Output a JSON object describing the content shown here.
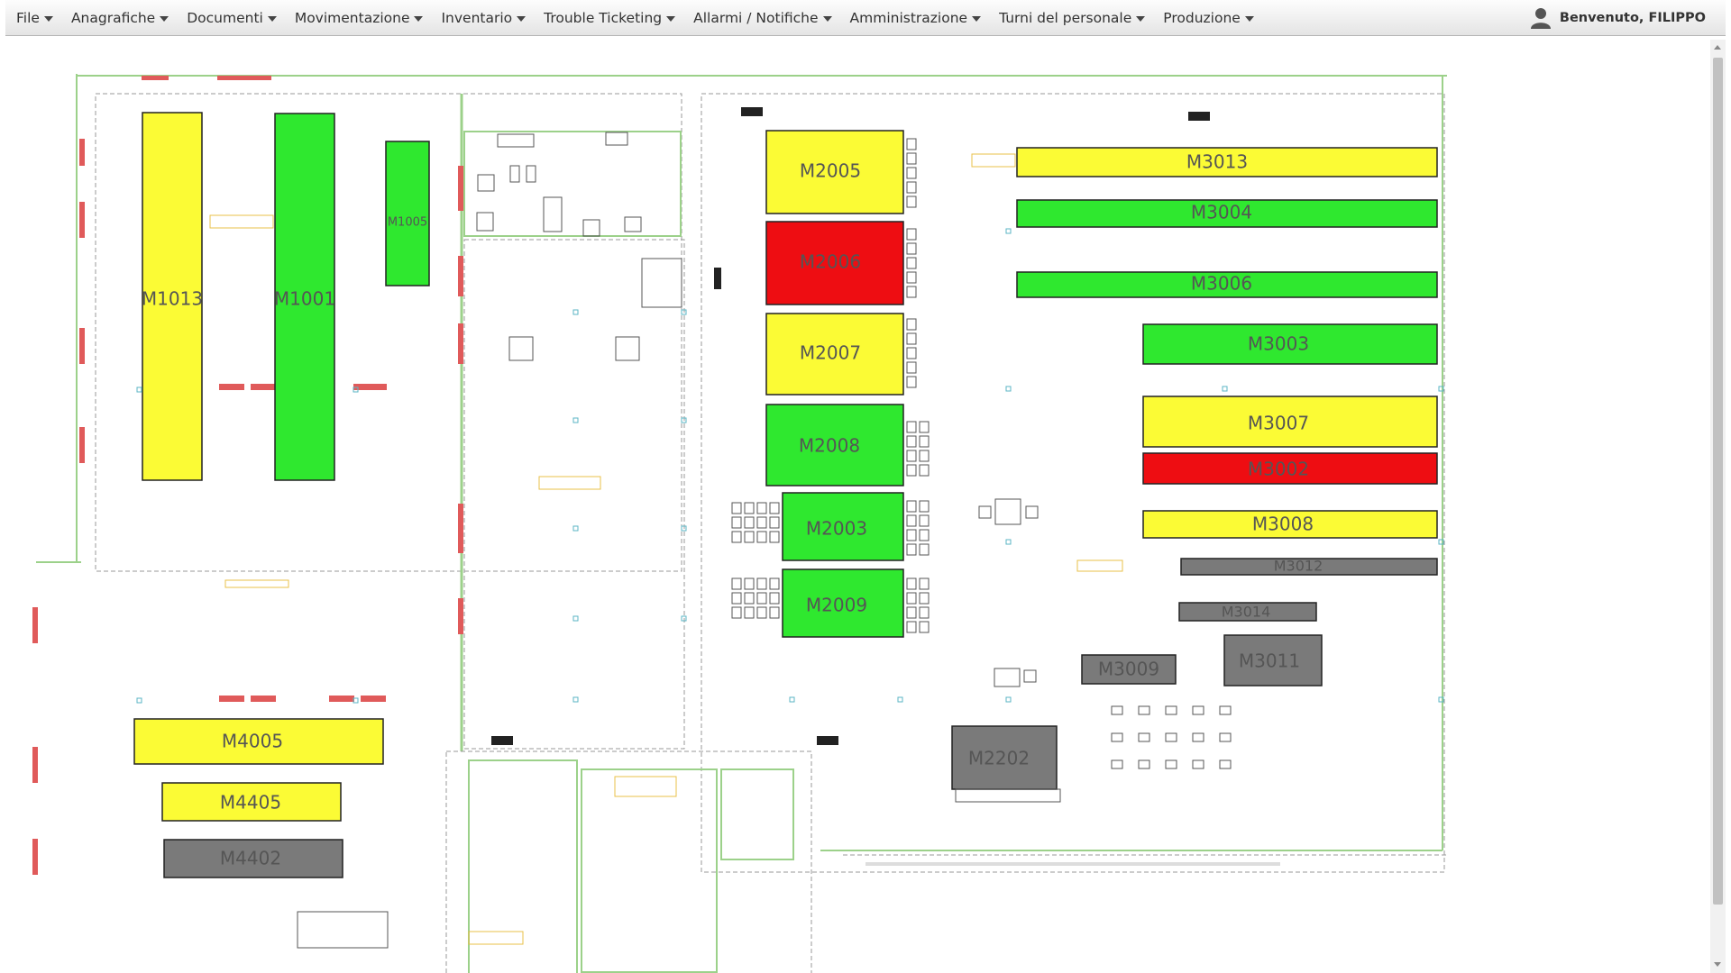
{
  "menu": [
    {
      "label": "File"
    },
    {
      "label": "Anagrafiche"
    },
    {
      "label": "Documenti"
    },
    {
      "label": "Movimentazione"
    },
    {
      "label": "Inventario"
    },
    {
      "label": "Trouble Ticketing"
    },
    {
      "label": "Allarmi / Notifiche"
    },
    {
      "label": "Amministrazione"
    },
    {
      "label": "Turni del personale"
    },
    {
      "label": "Produzione"
    }
  ],
  "user": {
    "greeting": "Benvenuto, FILIPPO",
    "icon": "user-icon"
  },
  "status_colors": {
    "running": "#2fe82f",
    "warning": "#fbfb35",
    "alarm": "#ee0d12",
    "offline": "#7a7a7a"
  },
  "machines": [
    {
      "label": "M1013",
      "status": "warning"
    },
    {
      "label": "M1001",
      "status": "running"
    },
    {
      "label": "M1005",
      "status": "running"
    },
    {
      "label": "M2005",
      "status": "warning"
    },
    {
      "label": "M2006",
      "status": "alarm"
    },
    {
      "label": "M2007",
      "status": "warning"
    },
    {
      "label": "M2008",
      "status": "running"
    },
    {
      "label": "M2003",
      "status": "running"
    },
    {
      "label": "M2009",
      "status": "running"
    },
    {
      "label": "M3013",
      "status": "warning"
    },
    {
      "label": "M3004",
      "status": "running"
    },
    {
      "label": "M3006",
      "status": "running"
    },
    {
      "label": "M3003",
      "status": "running"
    },
    {
      "label": "M3007",
      "status": "warning"
    },
    {
      "label": "M3002",
      "status": "alarm"
    },
    {
      "label": "M3008",
      "status": "warning"
    },
    {
      "label": "M3012",
      "status": "offline"
    },
    {
      "label": "M3014",
      "status": "offline"
    },
    {
      "label": "M3009",
      "status": "offline"
    },
    {
      "label": "M3011",
      "status": "offline"
    },
    {
      "label": "M2202",
      "status": "offline"
    },
    {
      "label": "M4005",
      "status": "warning"
    },
    {
      "label": "M4405",
      "status": "warning"
    },
    {
      "label": "M4402",
      "status": "offline"
    }
  ]
}
